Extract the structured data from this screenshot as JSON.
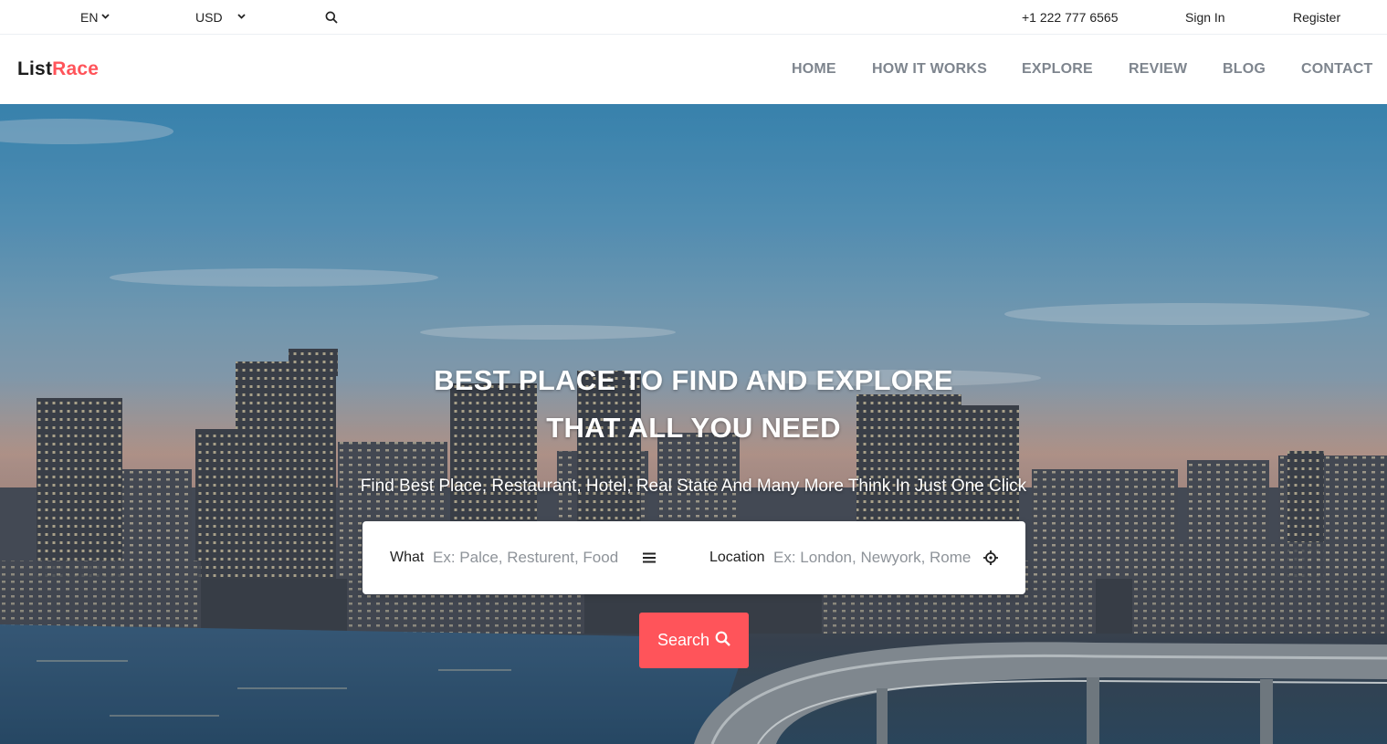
{
  "topbar": {
    "language": "EN",
    "currency": "USD",
    "phone": "+1 222 777 6565",
    "signin": "Sign In",
    "register": "Register",
    "icons": [
      "chevron-down-icon",
      "search-icon"
    ]
  },
  "navbar": {
    "logo_part1": "List",
    "logo_part2": "Race",
    "items": [
      "HOME",
      "HOW IT WORKS",
      "EXPLORE",
      "REVIEW",
      "BLOG",
      "CONTACT"
    ]
  },
  "hero": {
    "title_line1": "BEST PLACE TO FIND AND EXPLORE",
    "title_line2": "THAT ALL YOU NEED",
    "subtitle": "Find Best Place, Restaurant, Hotel, Real State And Many More Think In Just One Click",
    "search": {
      "what_label": "What",
      "what_placeholder": "Ex: Palce, Resturent, Food",
      "location_label": "Location",
      "location_placeholder": "Ex: London, Newyork, Rome",
      "button_label": "Search",
      "icons": [
        "menu-icon",
        "crosshair-icon",
        "search-icon"
      ]
    }
  },
  "colors": {
    "accent": "#ff545a",
    "nav_text": "#7e858e",
    "logo_dark": "#1c1c1c"
  }
}
